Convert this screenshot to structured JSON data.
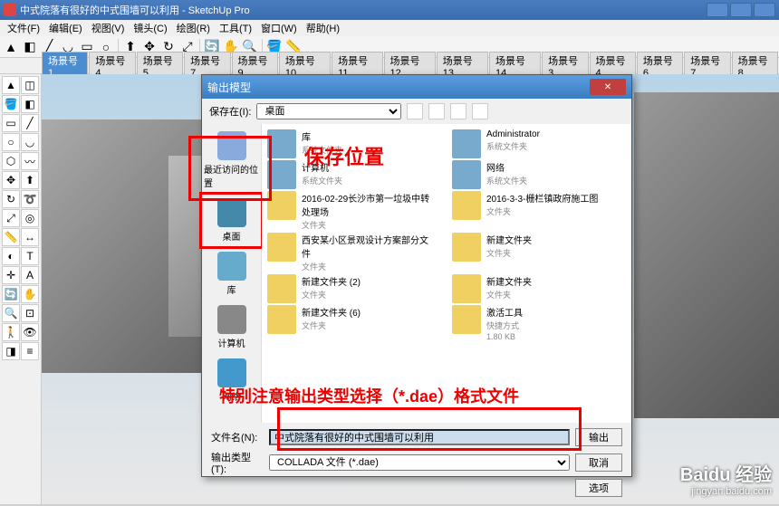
{
  "app": {
    "title": "中式院落有很好的中式围墙可以利用 - SketchUp Pro"
  },
  "menu": [
    "文件(F)",
    "编辑(E)",
    "视图(V)",
    "镜头(C)",
    "绘图(R)",
    "工具(T)",
    "窗口(W)",
    "帮助(H)"
  ],
  "scene_tabs": [
    "场景号1",
    "场景号4",
    "场景号5",
    "场景号7",
    "场景号9",
    "场景号10",
    "场景号11",
    "场景号12",
    "场景号13",
    "场景号14",
    "场景号3",
    "场景号4",
    "场景号6",
    "场景号7",
    "场景号8"
  ],
  "dialog": {
    "title": "输出模型",
    "save_in_label": "保存在(I):",
    "save_in_value": "桌面",
    "places": [
      {
        "label": "最近访问的位置"
      },
      {
        "label": "桌面"
      },
      {
        "label": "库"
      },
      {
        "label": "计算机"
      },
      {
        "label": "网络"
      }
    ],
    "files_left": [
      {
        "name": "库",
        "sub": "系统文件夹",
        "sys": true
      },
      {
        "name": "计算机",
        "sub": "系统文件夹",
        "sys": true
      },
      {
        "name": "2016-02-29长沙市第一垃圾中转处理场",
        "sub": "文件夹"
      },
      {
        "name": "西安某小区景观设计方案部分文件",
        "sub": "文件夹"
      },
      {
        "name": "新建文件夹 (2)",
        "sub": "文件夹"
      },
      {
        "name": "新建文件夹 (6)",
        "sub": "文件夹"
      }
    ],
    "files_right": [
      {
        "name": "Administrator",
        "sub": "系统文件夹",
        "sys": true
      },
      {
        "name": "网络",
        "sub": "系统文件夹",
        "sys": true
      },
      {
        "name": "2016-3-3-栅栏镇政府施工图",
        "sub": "文件夹"
      },
      {
        "name": "新建文件夹",
        "sub": "文件夹"
      },
      {
        "name": "新建文件夹",
        "sub": "文件夹"
      },
      {
        "name": "激活工具",
        "sub": "快捷方式",
        "extra": "1.80 KB"
      }
    ],
    "filename_label": "文件名(N):",
    "filename_value": "中式院落有很好的中式围墙可以利用",
    "filetype_label": "输出类型(T):",
    "filetype_value": "COLLADA 文件 (*.dae)",
    "export_btn": "输出",
    "cancel_btn": "取消",
    "options_btn": "选项"
  },
  "annotations": {
    "save_location": "保存位置",
    "note": "特别注意输出类型选择（*.dae）格式文件"
  },
  "watermark": {
    "brand": "Baidu 经验",
    "url": "jingyan.baidu.com"
  }
}
